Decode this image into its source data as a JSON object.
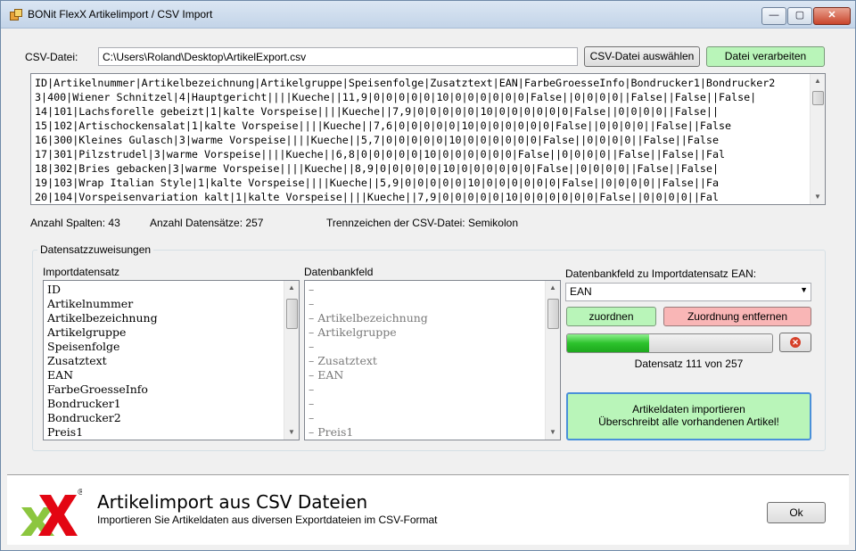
{
  "window": {
    "title": "BONit FlexX Artikelimport / CSV Import",
    "min_symbol": "—",
    "max_symbol": "▢",
    "close_symbol": "✕"
  },
  "csv": {
    "label": "CSV-Datei:",
    "path": "C:\\Users\\Roland\\Desktop\\ArtikelExport.csv",
    "select_button": "CSV-Datei auswählen",
    "process_button": "Datei verarbeiten",
    "lines": [
      "ID|Artikelnummer|Artikelbezeichnung|Artikelgruppe|Speisenfolge|Zusatztext|EAN|FarbeGroesseInfo|Bondrucker1|Bondrucker2",
      "3|400|Wiener Schnitzel|4|Hauptgericht||||Kueche||11,9|0|0|0|0|0|10|0|0|0|0|0|0|False||0|0|0|0||False||False||False|",
      "14|101|Lachsforelle gebeizt|1|kalte Vorspeise||||Kueche||7,9|0|0|0|0|0|10|0|0|0|0|0|0|False||0|0|0|0||False||",
      "15|102|Artischockensalat|1|kalte Vorspeise||||Kueche||7,6|0|0|0|0|0|10|0|0|0|0|0|0|False||0|0|0|0||False||False",
      "16|300|Kleines Gulasch|3|warme Vorspeise||||Kueche||5,7|0|0|0|0|0|10|0|0|0|0|0|0|False||0|0|0|0||False||False",
      "17|301|Pilzstrudel|3|warme Vorspeise||||Kueche||6,8|0|0|0|0|0|10|0|0|0|0|0|0|False||0|0|0|0||False||False||Fal",
      "18|302|Bries gebacken|3|warme Vorspeise||||Kueche||8,9|0|0|0|0|0|10|0|0|0|0|0|0|False||0|0|0|0||False||False|",
      "19|103|Wrap Italian Style|1|kalte Vorspeise||||Kueche||5,9|0|0|0|0|0|10|0|0|0|0|0|0|False||0|0|0|0||False||Fa",
      "20|104|Vorspeisenvariation kalt|1|kalte Vorspeise||||Kueche||7,9|0|0|0|0|0|10|0|0|0|0|0|0|False||0|0|0|0||Fal"
    ]
  },
  "stats": {
    "columns": "Anzahl Spalten: 43",
    "records": "Anzahl Datensätze: 257",
    "separator": "Trennzeichen der CSV-Datei: Semikolon"
  },
  "assignments": {
    "group_title": "Datensatzzuweisungen",
    "import_label": "Importdatensatz",
    "db_label": "Datenbankfeld",
    "import_items": [
      "ID",
      "Artikelnummer",
      "Artikelbezeichnung",
      "Artikelgruppe",
      "Speisenfolge",
      "Zusatztext",
      "EAN",
      "FarbeGroesseInfo",
      "Bondrucker1",
      "Bondrucker2",
      "Preis1"
    ],
    "db_items": [
      "–",
      "–",
      "– Artikelbezeichnung",
      "– Artikelgruppe",
      "–",
      "– Zusatztext",
      "– EAN",
      "–",
      "–",
      "–",
      "– Preis1"
    ],
    "field_label": "Datenbankfeld zu Importdatensatz EAN:",
    "combo_value": "EAN",
    "assign_button": "zuordnen",
    "remove_button": "Zuordnung entfernen",
    "progress_fraction": 0.4,
    "progress_text": "Datensatz 111 von 257",
    "import_button_line1": "Artikeldaten importieren",
    "import_button_line2": "Überschreibt alle vorhandenen Artikel!"
  },
  "footer": {
    "title": "Artikelimport aus CSV Dateien",
    "subtitle": "Importieren Sie Artikeldaten aus diversen Exportdateien im CSV-Format",
    "ok_button": "Ok",
    "registered": "®"
  },
  "colors": {
    "green_button": "#b9f5b9",
    "red_button": "#f9b6b6",
    "progress_green": "#2cc22c",
    "logo_green": "#8cc63f",
    "logo_red": "#e30613"
  }
}
